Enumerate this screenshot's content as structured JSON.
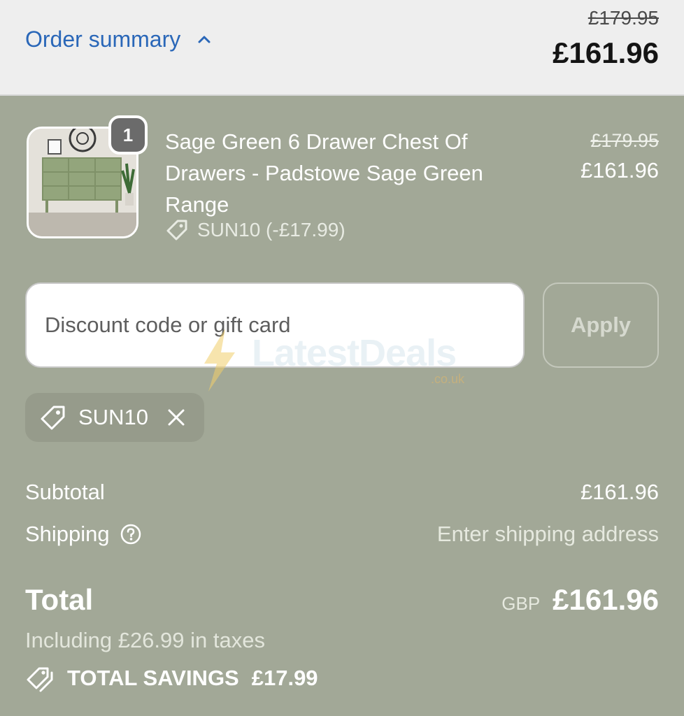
{
  "header": {
    "toggle_label": "Order summary",
    "original_total": "£179.95",
    "total": "£161.96"
  },
  "item": {
    "quantity": "1",
    "name": "Sage Green 6 Drawer Chest Of Drawers - Padstowe Sage Green Range",
    "discount": "SUN10 (-£17.99)",
    "original_price": "£179.95",
    "price": "£161.96"
  },
  "discount_form": {
    "placeholder": "Discount code or gift card",
    "apply_label": "Apply"
  },
  "watermark": {
    "text": "LatestDeals",
    "sub": ".co.uk"
  },
  "applied_code": {
    "code": "SUN10"
  },
  "totals": {
    "subtotal_label": "Subtotal",
    "subtotal_value": "£161.96",
    "shipping_label": "Shipping",
    "shipping_value": "Enter shipping address",
    "total_label": "Total",
    "currency": "GBP",
    "total_value": "£161.96",
    "taxes_note": "Including £26.99 in taxes",
    "savings_label": "TOTAL SAVINGS",
    "savings_value": "£17.99"
  },
  "icons": {
    "summary_toggle": "chevron-up-icon",
    "discount_tag": "tag-icon",
    "remove_code": "close-icon",
    "shipping_help": "question-circle-icon",
    "savings": "tags-icon"
  },
  "colors": {
    "accent": "#2a67b8",
    "panel_bg": "#a2a897",
    "header_bg": "#eeeeee"
  }
}
